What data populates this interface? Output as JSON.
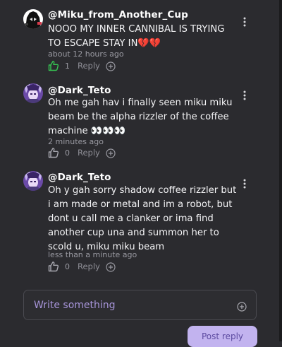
{
  "comments": [
    {
      "username": "@Miku_from_Another_Cup",
      "text": "NOOO MY INNER CANNIBAL IS TRYING TO ESCAPE STAY IN💔💔",
      "timestamp": "about 12 hours ago",
      "likes": "1",
      "liked": true,
      "reply_label": "Reply"
    },
    {
      "username": "@Dark_Teto",
      "text": "Oh me gah hav i finally seen miku miku beam be the alpha rizzler of the coffee machine 👀👀👀",
      "timestamp": "2 minutes ago",
      "likes": "0",
      "liked": false,
      "reply_label": "Reply"
    },
    {
      "username": "@Dark_Teto",
      "text": "Oh y gah sorry shadow coffee rizzler but i am made or metal and im a robot, but dont u call me a clanker or ima find another cup una and summon her to scold u, miku miku beam",
      "timestamp": "less than a minute ago",
      "likes": "0",
      "liked": false,
      "reply_label": "Reply"
    }
  ],
  "composer": {
    "placeholder": "Write something",
    "value": ""
  },
  "post_button_label": "Post reply",
  "icons": {
    "like": "thumbs-up-icon",
    "add": "plus-circle-icon",
    "more": "more-vertical-icon"
  },
  "colors": {
    "background": "#2b2b2f",
    "liked_green": "#36c552",
    "accent_purple": "#c2b3ef",
    "placeholder_purple": "#a694d8"
  }
}
